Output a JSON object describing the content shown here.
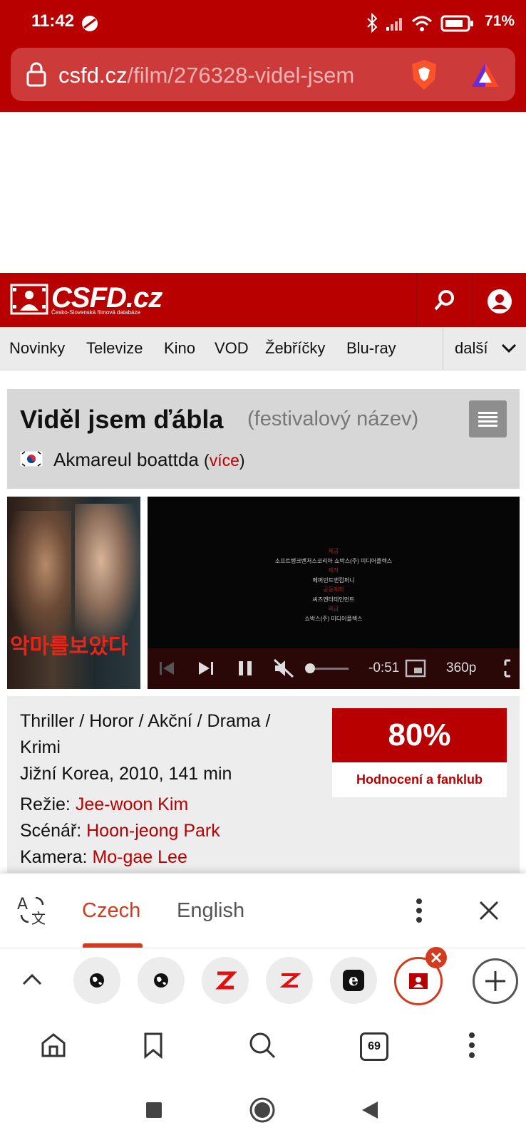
{
  "status_bar": {
    "time": "11:42",
    "battery": "71%"
  },
  "browser": {
    "url_host": "csfd.cz",
    "url_path": "/film/276328-videl-jsem"
  },
  "site": {
    "logo": "CSFD.cz",
    "tagline": "Česko-Slovenská filmová databáze",
    "nav": [
      "Novinky",
      "Televize",
      "Kino",
      "VOD",
      "Žebříčky",
      "Blu-ray"
    ],
    "nav_more": "další"
  },
  "film": {
    "title": "Viděl jsem ďábla",
    "title_note": "(festivalový název)",
    "original_title": "Akmareul boattda",
    "more_link": "více",
    "genres_line1": "Thriller / Horor / Akční / Drama /",
    "genres_line2": "Krimi",
    "origin": "Jižní Korea, 2010, 141 min",
    "director_label": "Režie:",
    "director": "Jee-woon Kim",
    "writer_label": "Scénář:",
    "writer": "Hoon-jeong Park",
    "camera_label": "Kamera:",
    "camera": "Mo-gae Lee",
    "rating": "80%",
    "rating_label": "Hodnocení a fanklub"
  },
  "poster": {
    "korean_title": "악마를보았다"
  },
  "video": {
    "time_remaining": "-0:51",
    "quality": "360p",
    "credits": [
      "제공",
      "소프트뱅크벤처스코리아 쇼박스(주) 미디어플렉스",
      "제작",
      "페퍼민트앤컴퍼니",
      "공동제작",
      "씨즈엔터테인먼트",
      "배급",
      "쇼박스(주) 미디어플렉스"
    ]
  },
  "translate_bar": {
    "tabs": [
      "Czech",
      "English"
    ],
    "active": "Czech"
  },
  "tab_strip": {
    "open_tabs_count": "69"
  },
  "colors": {
    "brand_red": "#b80000",
    "accent_orange": "#d33b1f"
  }
}
